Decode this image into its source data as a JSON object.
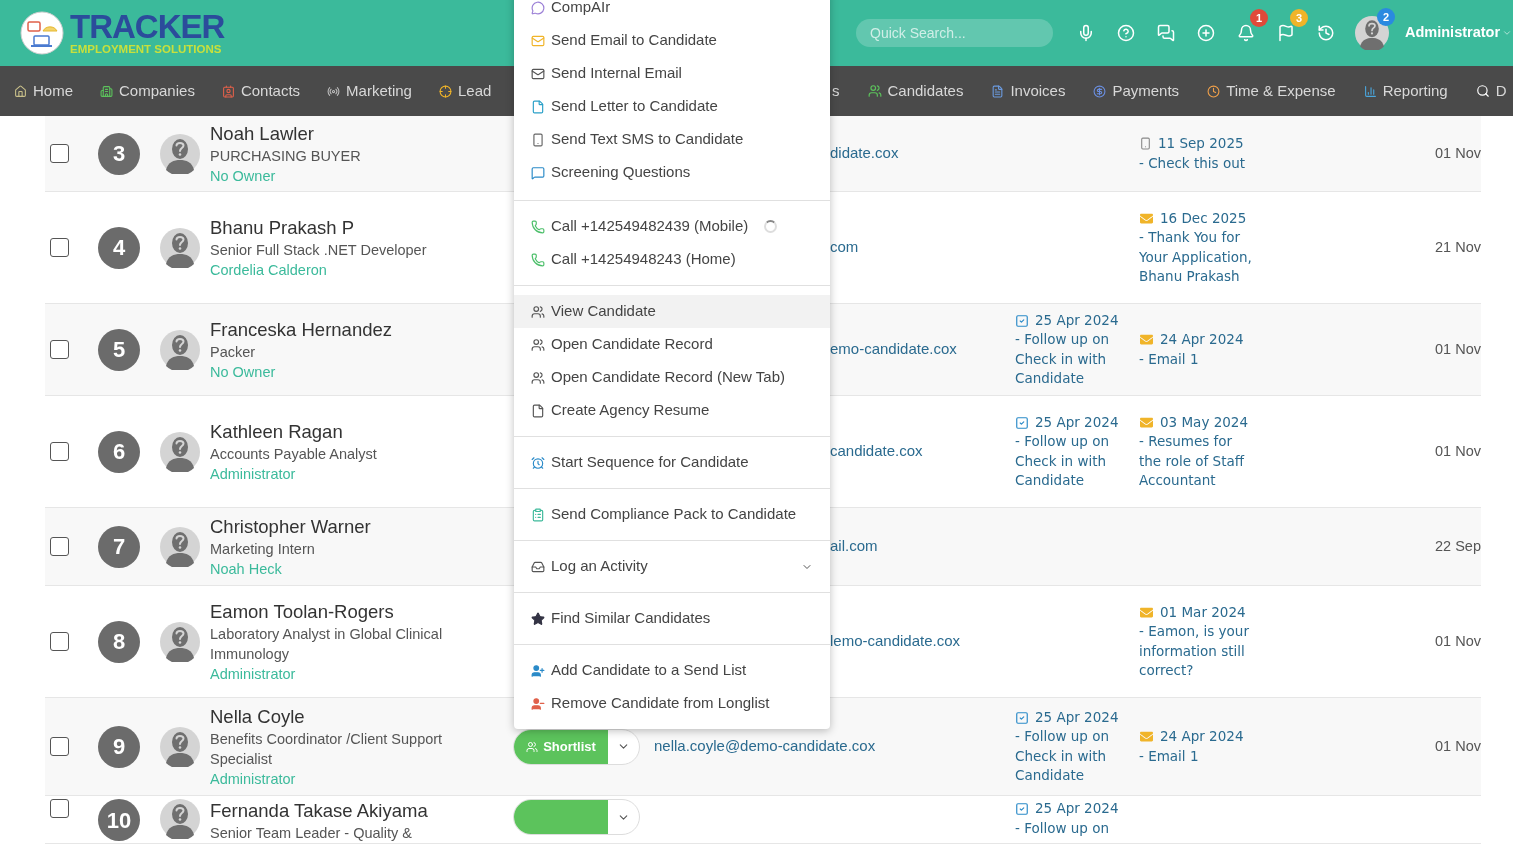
{
  "header": {
    "logo": {
      "title": "TRACKER",
      "subtitle": "EMPLOYMENT SOLUTIONS"
    },
    "search": {
      "placeholder": "Quick Search..."
    },
    "notification_count": "1",
    "flag_count": "3",
    "user": {
      "name": "Administrator",
      "badge": "2"
    }
  },
  "nav_left": [
    {
      "label": "Home"
    },
    {
      "label": "Companies"
    },
    {
      "label": "Contacts"
    },
    {
      "label": "Marketing"
    },
    {
      "label": "Lead"
    }
  ],
  "nav_right": [
    {
      "label": "s"
    },
    {
      "label": "Candidates"
    },
    {
      "label": "Invoices"
    },
    {
      "label": "Payments"
    },
    {
      "label": "Time & Expense"
    },
    {
      "label": "Reporting"
    },
    {
      "label": "D"
    }
  ],
  "menu": {
    "sections": [
      [
        {
          "label": "CompAIr",
          "kind": "action",
          "highlighted": false,
          "loading": false
        },
        {
          "label": "Send Email to Candidate",
          "kind": "action",
          "highlighted": false,
          "loading": false
        },
        {
          "label": "Send Internal Email",
          "kind": "action",
          "highlighted": false,
          "loading": false
        },
        {
          "label": "Send Letter to Candidate",
          "kind": "action",
          "highlighted": false,
          "loading": false
        },
        {
          "label": "Send Text SMS to Candidate",
          "kind": "action",
          "highlighted": false,
          "loading": false
        },
        {
          "label": "Screening Questions",
          "kind": "action",
          "highlighted": false,
          "loading": false
        }
      ],
      [
        {
          "label": "Call +142549482439 (Mobile)",
          "kind": "action",
          "highlighted": false,
          "loading": true
        },
        {
          "label": "Call +14254948243 (Home)",
          "kind": "action",
          "highlighted": false,
          "loading": false
        }
      ],
      [
        {
          "label": "View Candidate",
          "kind": "action",
          "highlighted": true,
          "loading": false
        },
        {
          "label": "Open Candidate Record",
          "kind": "action",
          "highlighted": false,
          "loading": false
        },
        {
          "label": "Open Candidate Record (New Tab)",
          "kind": "action",
          "highlighted": false,
          "loading": false
        },
        {
          "label": "Create Agency Resume",
          "kind": "action",
          "highlighted": false,
          "loading": false
        }
      ],
      [
        {
          "label": "Start Sequence for Candidate",
          "kind": "action",
          "highlighted": false,
          "loading": false
        }
      ],
      [
        {
          "label": "Send Compliance Pack to Candidate",
          "kind": "action",
          "highlighted": false,
          "loading": false
        }
      ],
      [
        {
          "label": "Log an Activity",
          "kind": "submenu",
          "highlighted": false,
          "loading": false
        }
      ],
      [
        {
          "label": "Find Similar Candidates",
          "kind": "action",
          "highlighted": false,
          "loading": false
        }
      ],
      [
        {
          "label": "Add Candidate to a Send List",
          "kind": "action",
          "highlighted": false,
          "loading": false
        },
        {
          "label": "Remove Candidate from Longlist",
          "kind": "action",
          "highlighted": false,
          "loading": false
        }
      ]
    ]
  },
  "rows": [
    {
      "checked": false,
      "number": "3",
      "name": "Noah Lawler",
      "title": "PURCHASING BUYER",
      "owner": "No Owner",
      "kind": "covered",
      "email": "didate.cox",
      "activity": {
        "kind": "text_message",
        "date": "11 Sep 2025",
        "text": "- Check this out"
      },
      "date": "01 Nov"
    },
    {
      "checked": false,
      "number": "4",
      "name": "Bhanu Prakash P",
      "title": "Senior Full Stack .NET Developer",
      "owner": "Cordelia Calderon",
      "kind": "covered",
      "email": "com",
      "activity": {
        "kind": "email",
        "date": "16 Dec 2025",
        "text": "- Thank You for Your Application, Bhanu Prakash"
      },
      "date": "21 Nov"
    },
    {
      "checked": false,
      "number": "5",
      "name": "Franceska Hernandez",
      "title": "Packer",
      "owner": "No Owner",
      "kind": "covered",
      "email": "emo-candidate.cox",
      "task": {
        "date": "25 Apr 2024",
        "text": "- Follow up on Check in with Candidate"
      },
      "activity": {
        "kind": "email",
        "date": "24 Apr 2024",
        "text": "- Email 1"
      },
      "date": "01 Nov"
    },
    {
      "checked": false,
      "number": "6",
      "name": "Kathleen Ragan",
      "title": "Accounts Payable Analyst",
      "owner": "Administrator",
      "kind": "covered",
      "email": "candidate.cox",
      "task": {
        "date": "25 Apr 2024",
        "text": "- Follow up on Check in with Candidate"
      },
      "activity": {
        "kind": "email",
        "date": "03 May 2024",
        "text": "- Resumes for the role of Staff Accountant"
      },
      "date": "01 Nov"
    },
    {
      "checked": false,
      "number": "7",
      "name": "Christopher Warner",
      "title": "Marketing Intern",
      "owner": "Noah Heck",
      "kind": "covered",
      "email": "ail.com",
      "date": "22 Sep"
    },
    {
      "checked": false,
      "number": "8",
      "name": "Eamon Toolan-Rogers",
      "title": "Laboratory Analyst in Global Clinical Immunology",
      "owner": "Administrator",
      "kind": "covered",
      "email": "lemo-candidate.cox",
      "activity": {
        "kind": "email",
        "date": "01 Mar 2024",
        "text": "- Eamon, is your information still correct?"
      },
      "date": "01 Nov"
    },
    {
      "checked": false,
      "number": "9",
      "name": "Nella Coyle",
      "title": "Benefits Coordinator /Client Support Specialist",
      "owner": "Administrator",
      "kind": "full",
      "button_label": "Shortlist",
      "email": "nella.coyle@demo-candidate.cox",
      "task": {
        "date": "25 Apr 2024",
        "text": "- Follow up on Check in with Candidate"
      },
      "activity": {
        "kind": "email",
        "date": "24 Apr 2024",
        "text": "- Email 1"
      },
      "date": "01 Nov"
    },
    {
      "checked": false,
      "number": "10",
      "name": "Fernanda Takase Akiyama",
      "title": "Senior Team Leader - Quality &",
      "kind": "full",
      "task": {
        "date": "25 Apr 2024",
        "text": "- Follow up on"
      }
    }
  ]
}
